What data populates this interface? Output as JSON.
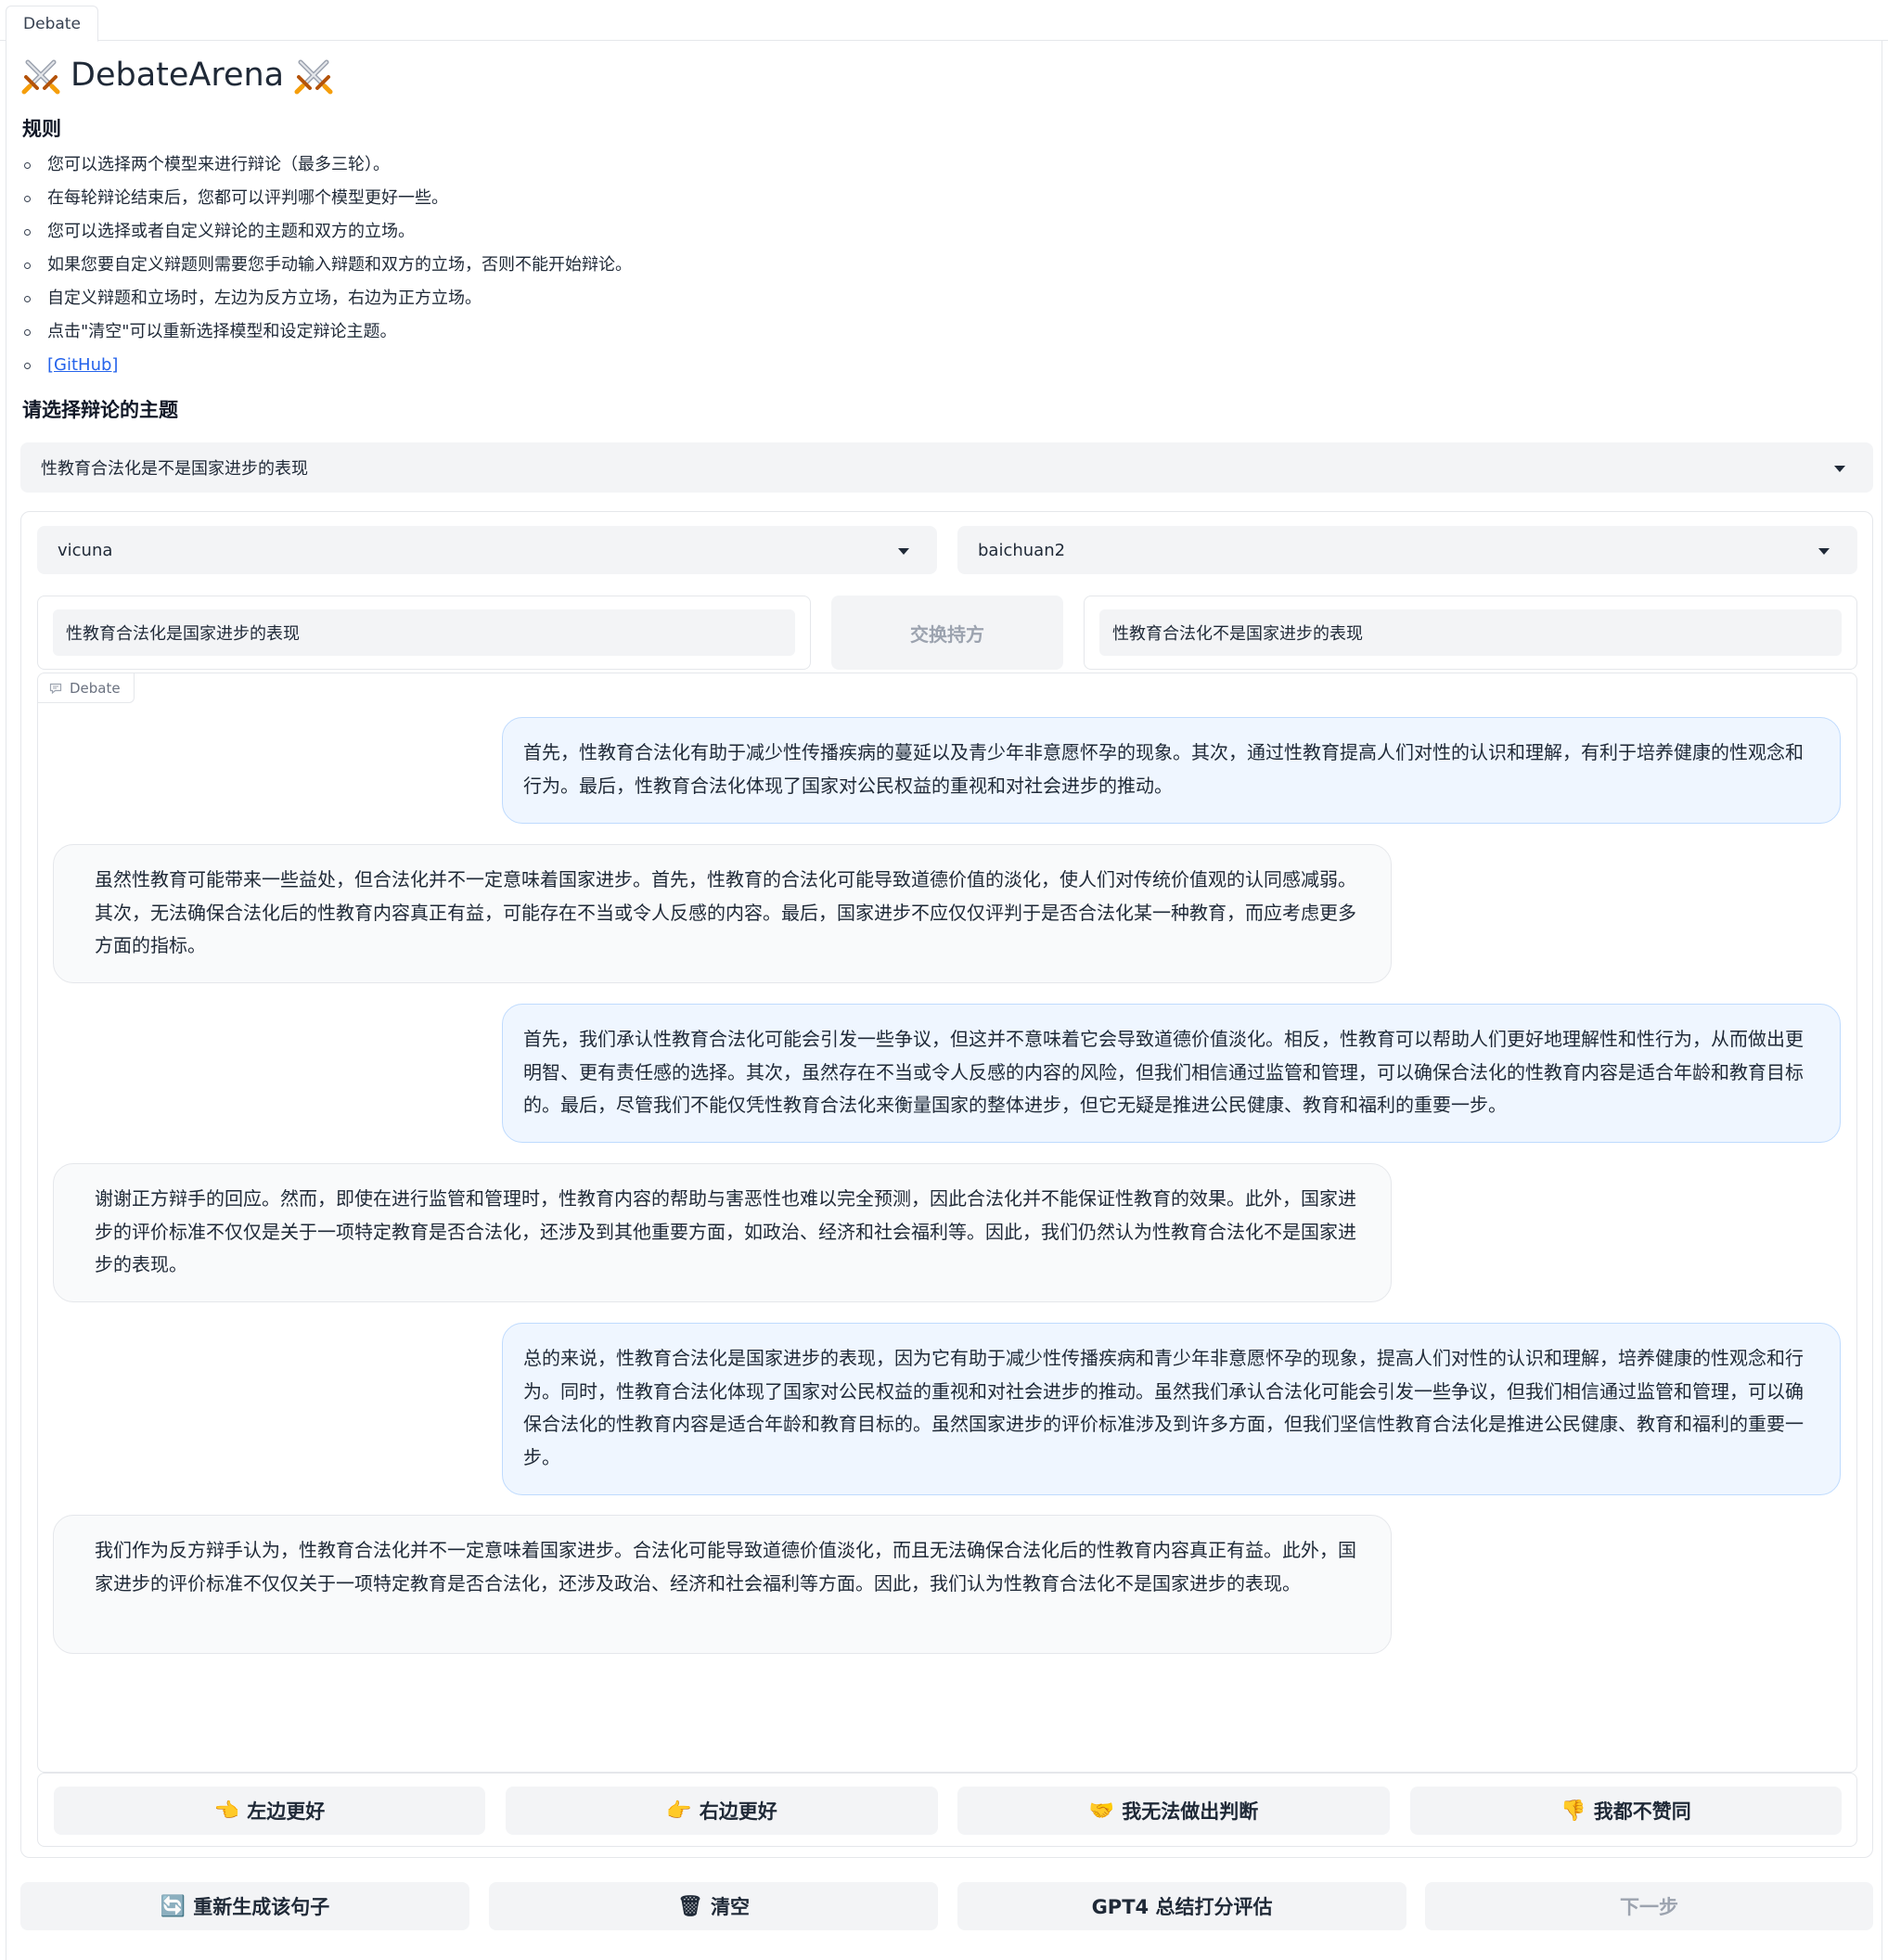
{
  "tab": {
    "label": "Debate"
  },
  "header": {
    "title": "DebateArena"
  },
  "rules": {
    "heading": "规则",
    "items": [
      "您可以选择两个模型来进行辩论（最多三轮）。",
      "在每轮辩论结束后，您都可以评判哪个模型更好一些。",
      "您可以选择或者自定义辩论的主题和双方的立场。",
      "如果您要自定义辩题则需要您手动输入辩题和双方的立场，否则不能开始辩论。",
      "自定义辩题和立场时，左边为反方立场，右边为正方立场。",
      "点击\"清空\"可以重新选择模型和设定辩论主题。"
    ],
    "link": "[GitHub]"
  },
  "topic": {
    "heading": "请选择辩论的主题",
    "selected": "性教育合法化是不是国家进步的表现"
  },
  "models": {
    "left": "vicuna",
    "right": "baichuan2"
  },
  "stances": {
    "left": "性教育合法化是国家进步的表现",
    "swap_label": "交换持方",
    "right": "性教育合法化不是国家进步的表现"
  },
  "chat": {
    "label": "Debate",
    "messages": [
      {
        "side": "right",
        "text": "首先，性教育合法化有助于减少性传播疾病的蔓延以及青少年非意愿怀孕的现象。其次，通过性教育提高人们对性的认识和理解，有利于培养健康的性观念和行为。最后，性教育合法化体现了国家对公民权益的重视和对社会进步的推动。"
      },
      {
        "side": "left",
        "text": "虽然性教育可能带来一些益处，但合法化并不一定意味着国家进步。首先，性教育的合法化可能导致道德价值的淡化，使人们对传统价值观的认同感减弱。其次，无法确保合法化后的性教育内容真正有益，可能存在不当或令人反感的内容。最后，国家进步不应仅仅评判于是否合法化某一种教育，而应考虑更多方面的指标。"
      },
      {
        "side": "right",
        "text": "首先，我们承认性教育合法化可能会引发一些争议，但这并不意味着它会导致道德价值淡化。相反，性教育可以帮助人们更好地理解性和性行为，从而做出更明智、更有责任感的选择。其次，虽然存在不当或令人反感的内容的风险，但我们相信通过监管和管理，可以确保合法化的性教育内容是适合年龄和教育目标的。最后，尽管我们不能仅凭性教育合法化来衡量国家的整体进步，但它无疑是推进公民健康、教育和福利的重要一步。"
      },
      {
        "side": "left",
        "text": "谢谢正方辩手的回应。然而，即使在进行监管和管理时，性教育内容的帮助与害恶性也难以完全预测，因此合法化并不能保证性教育的效果。此外，国家进步的评价标准不仅仅是关于一项特定教育是否合法化，还涉及到其他重要方面，如政治、经济和社会福利等。因此，我们仍然认为性教育合法化不是国家进步的表现。"
      },
      {
        "side": "right",
        "text": "总的来说，性教育合法化是国家进步的表现，因为它有助于减少性传播疾病和青少年非意愿怀孕的现象，提高人们对性的认识和理解，培养健康的性观念和行为。同时，性教育合法化体现了国家对公民权益的重视和对社会进步的推动。虽然我们承认合法化可能会引发一些争议，但我们相信通过监管和管理，可以确保合法化的性教育内容是适合年龄和教育目标的。虽然国家进步的评价标准涉及到许多方面，但我们坚信性教育合法化是推进公民健康、教育和福利的重要一步。"
      },
      {
        "side": "left",
        "text": "我们作为反方辩手认为，性教育合法化并不一定意味着国家进步。合法化可能导致道德价值淡化，而且无法确保合法化后的性教育内容真正有益。此外，国家进步的评价标准不仅仅关于一项特定教育是否合法化，还涉及政治、经济和社会福利等方面。因此，我们认为性教育合法化不是国家进步的表现。"
      }
    ]
  },
  "votes": {
    "left_better": {
      "icon": "👈",
      "label": "左边更好"
    },
    "right_better": {
      "icon": "👉",
      "label": "右边更好"
    },
    "cannot_judge": {
      "icon": "🤝",
      "label": "我无法做出判断"
    },
    "neither": {
      "icon": "👎",
      "label": "我都不赞同"
    }
  },
  "actions": {
    "regenerate": {
      "icon": "🔄",
      "label": "重新生成该句子"
    },
    "clear": {
      "icon": "🗑",
      "label": "清空"
    },
    "gpt4": {
      "label": "GPT4 总结打分评估"
    },
    "next": {
      "label": "下一步"
    }
  }
}
